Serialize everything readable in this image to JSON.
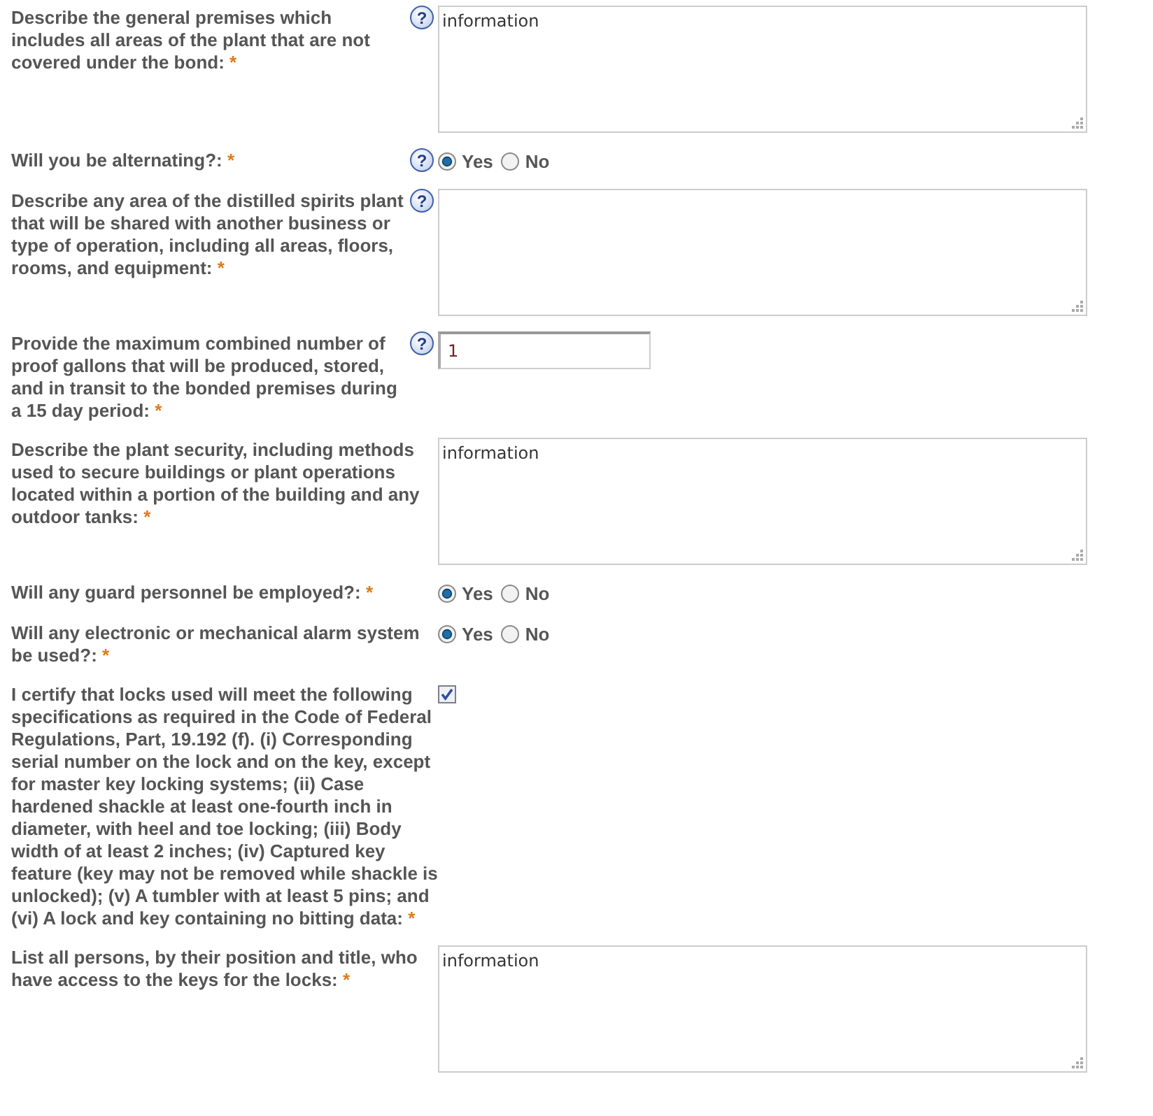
{
  "fields": [
    {
      "kind": "textarea",
      "label": "Describe the general premises which includes all areas of the plant that are not covered under the bond:",
      "required_mark": "*",
      "help": "?",
      "value": "information"
    },
    {
      "kind": "radio",
      "label": "Will you be alternating?:",
      "required_mark": "*",
      "help": "?",
      "options": [
        {
          "label": "Yes",
          "selected": true
        },
        {
          "label": "No",
          "selected": false
        }
      ]
    },
    {
      "kind": "textarea",
      "label": "Describe any area of the distilled spirits plant that will be shared with another business or type of operation, including all areas, floors, rooms, and equipment:",
      "required_mark": "*",
      "help": "?"
    },
    {
      "kind": "text",
      "label": "Provide the maximum combined number of proof gallons that will be produced, stored, and in transit to the bonded premises during a 15 day period:",
      "required_mark": "*",
      "help": "?",
      "value": "1"
    },
    {
      "kind": "textarea",
      "label": "Describe the plant security, including methods used to secure buildings or plant operations located within a portion of the building and any outdoor tanks:",
      "required_mark": "*",
      "value": "information"
    },
    {
      "kind": "radio",
      "label": "Will any guard personnel be employed?:",
      "required_mark": "*",
      "options": [
        {
          "label": "Yes",
          "selected": true
        },
        {
          "label": "No",
          "selected": false
        }
      ]
    },
    {
      "kind": "radio",
      "label": "Will any electronic or mechanical alarm system be used?:",
      "required_mark": "*",
      "options": [
        {
          "label": "Yes",
          "selected": true
        },
        {
          "label": "No",
          "selected": false
        }
      ]
    },
    {
      "kind": "checkbox",
      "label": "I certify that locks used will meet the following specifications as required in the Code of Federal Regulations, Part, 19.192 (f). (i) Corresponding serial number on the lock and on the key, except for master key locking systems; (ii) Case hardened shackle at least one-fourth inch in diameter, with heel and toe locking; (iii) Body width of at least 2 inches; (iv) Captured key feature (key may not be removed while shackle is unlocked); (v) A tumbler with at least 5 pins; and (vi) A lock and key containing no bitting data:",
      "required_mark": "*",
      "checked": true
    },
    {
      "kind": "textarea",
      "label": "List all persons, by their position and title, who have access to the keys for the locks:",
      "required_mark": "*",
      "value": "information"
    }
  ]
}
